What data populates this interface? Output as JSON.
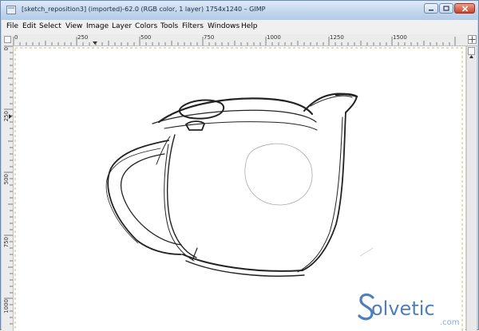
{
  "window": {
    "title": "[sketch_reposition3] (imported)-62.0 (RGB color, 1 layer) 1754x1240 – GIMP"
  },
  "menubar": {
    "items": [
      {
        "id": "file",
        "label": "File"
      },
      {
        "id": "edit",
        "label": "Edit"
      },
      {
        "id": "select",
        "label": "Select"
      },
      {
        "id": "view",
        "label": "View"
      },
      {
        "id": "image",
        "label": "Image"
      },
      {
        "id": "layer",
        "label": "Layer"
      },
      {
        "id": "colors",
        "label": "Colors"
      },
      {
        "id": "tools",
        "label": "Tools"
      },
      {
        "id": "filters",
        "label": "Filters"
      },
      {
        "id": "windows",
        "label": "Windows"
      },
      {
        "id": "help",
        "label": "Help"
      }
    ]
  },
  "rulers": {
    "horizontal": [
      "0",
      "250",
      "500",
      "750",
      "1000",
      "1250",
      "1500"
    ],
    "vertical": [
      "0",
      "250",
      "500",
      "750",
      "1000"
    ]
  },
  "watermark": {
    "brand": "olvetic",
    "suffix": ".com"
  },
  "colors": {
    "titlebar": "#c3d7ee",
    "menubar": "#f0f0f0",
    "canvas": "#ffffff",
    "sketch_stroke": "#222222",
    "watermark": "#4f7fb8"
  }
}
